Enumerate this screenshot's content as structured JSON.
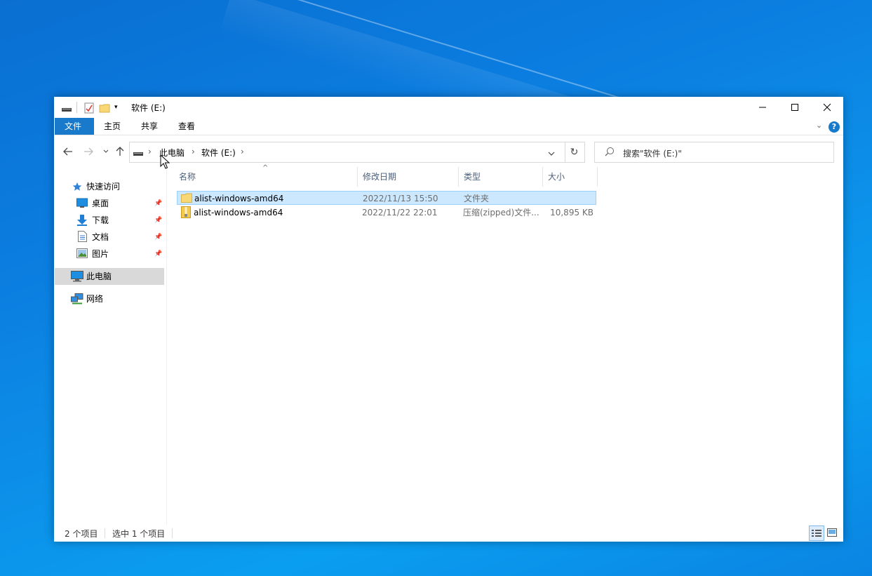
{
  "window": {
    "title": "软件 (E:)"
  },
  "ribbon": {
    "tabs": [
      "文件",
      "主页",
      "共享",
      "查看"
    ]
  },
  "address": {
    "segments": [
      "此电脑",
      "软件 (E:)"
    ]
  },
  "search": {
    "placeholder": "搜索\"软件 (E:)\""
  },
  "sidebar": {
    "quick_access": "快速访问",
    "items": [
      {
        "label": "桌面"
      },
      {
        "label": "下载"
      },
      {
        "label": "文档"
      },
      {
        "label": "图片"
      }
    ],
    "this_pc": "此电脑",
    "network": "网络"
  },
  "columns": {
    "name": "名称",
    "date": "修改日期",
    "type": "类型",
    "size": "大小"
  },
  "files": [
    {
      "name": "alist-windows-amd64",
      "date": "2022/11/13 15:50",
      "type": "文件夹",
      "size": ""
    },
    {
      "name": "alist-windows-amd64",
      "date": "2022/11/22 22:01",
      "type": "压缩(zipped)文件...",
      "size": "10,895 KB"
    }
  ],
  "status": {
    "count": "2 个项目",
    "selected": "选中 1 个项目"
  },
  "colors": {
    "accent": "#1979ca",
    "selection": "#cce8ff"
  }
}
